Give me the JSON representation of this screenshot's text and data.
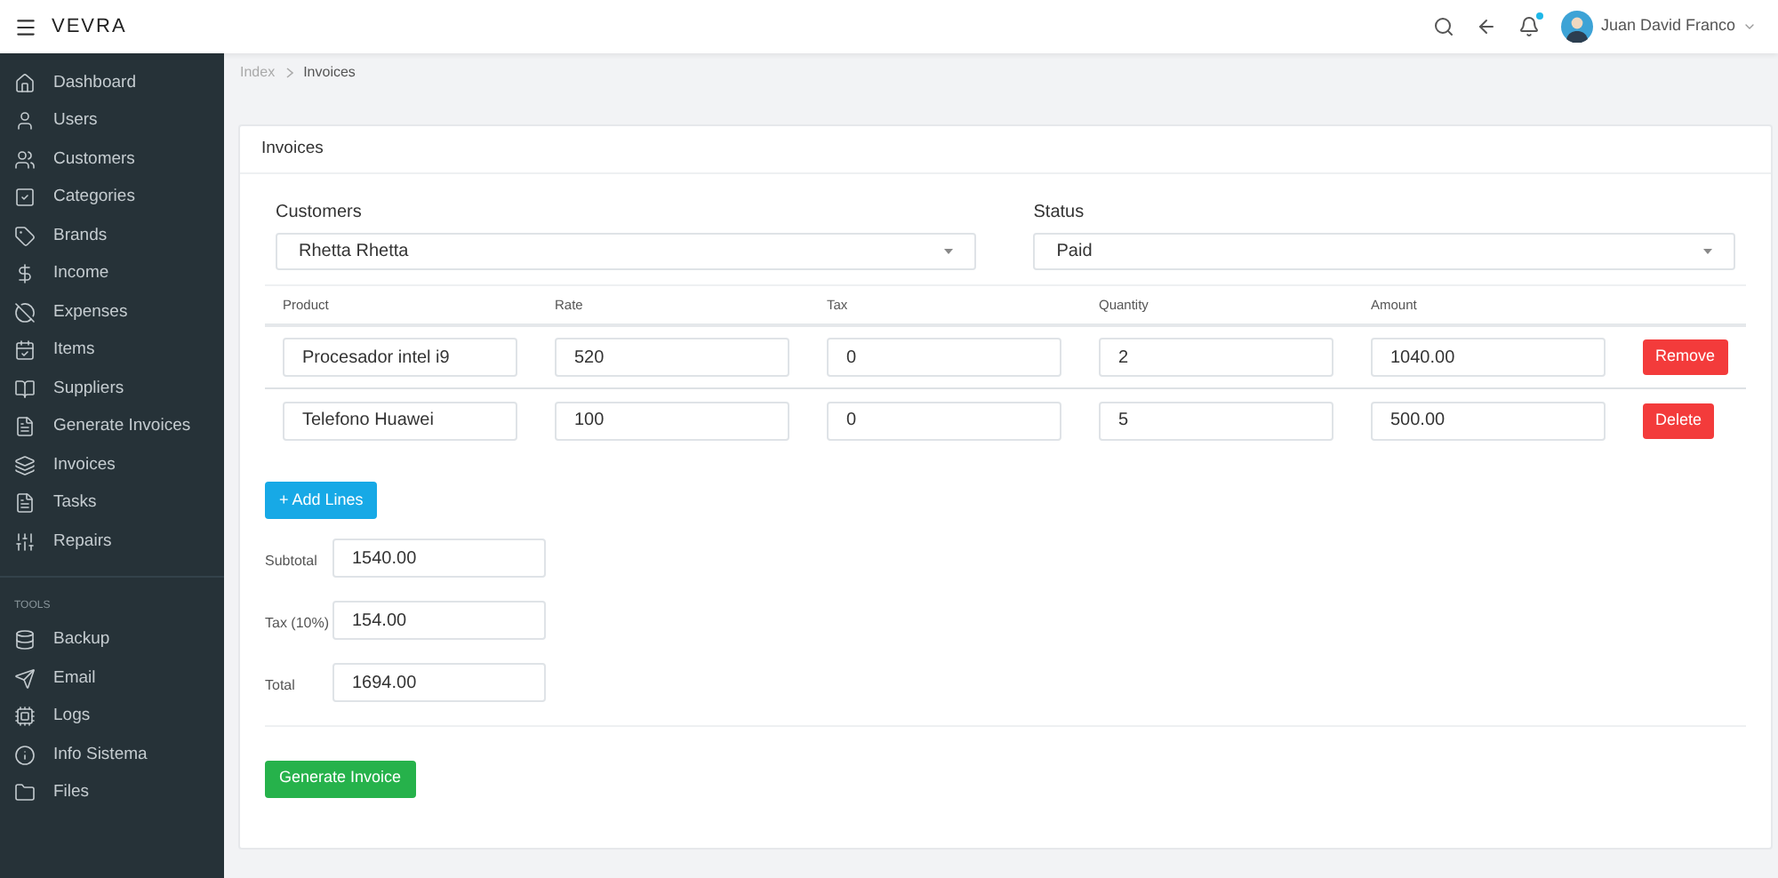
{
  "topbar": {
    "logo": "VEVRA",
    "user": "Juan David Franco",
    "notification_dot": true
  },
  "sidebar": {
    "items": [
      {
        "label": "Dashboard"
      },
      {
        "label": "Users"
      },
      {
        "label": "Customers"
      },
      {
        "label": "Categories"
      },
      {
        "label": "Brands"
      },
      {
        "label": "Income"
      },
      {
        "label": "Expenses"
      },
      {
        "label": "Items"
      },
      {
        "label": "Suppliers"
      },
      {
        "label": "Generate Invoices"
      },
      {
        "label": "Invoices"
      },
      {
        "label": "Tasks"
      },
      {
        "label": "Repairs"
      }
    ],
    "tools_heading": "TOOLS",
    "tools": [
      {
        "label": "Backup"
      },
      {
        "label": "Email"
      },
      {
        "label": "Logs"
      },
      {
        "label": "Info Sistema"
      },
      {
        "label": "Files"
      }
    ]
  },
  "breadcrumb": [
    "Index",
    "Invoices"
  ],
  "card": {
    "title": "Invoices",
    "customer": {
      "label": "Customers",
      "value": "Rhetta Rhetta"
    },
    "status": {
      "label": "Status",
      "value": "Paid"
    },
    "columns": [
      "Product",
      "Rate",
      "Tax",
      "Quantity",
      "Amount"
    ],
    "rows": [
      {
        "product": "Procesador intel i9",
        "rate": "520",
        "tax": "0",
        "quantity": "2",
        "amount": "1040.00",
        "action": "Remove"
      },
      {
        "product": "Telefono Huawei",
        "rate": "100",
        "tax": "0",
        "quantity": "5",
        "amount": "500.00",
        "action": "Delete"
      }
    ],
    "add_button": "+ Add Lines",
    "totals": [
      {
        "label": "Subtotal",
        "value": "1540.00"
      },
      {
        "label": "Tax (10%)",
        "value": "154.00"
      },
      {
        "label": "Total",
        "value": "1694.00"
      }
    ],
    "submit_button": "Generate Invoice"
  }
}
